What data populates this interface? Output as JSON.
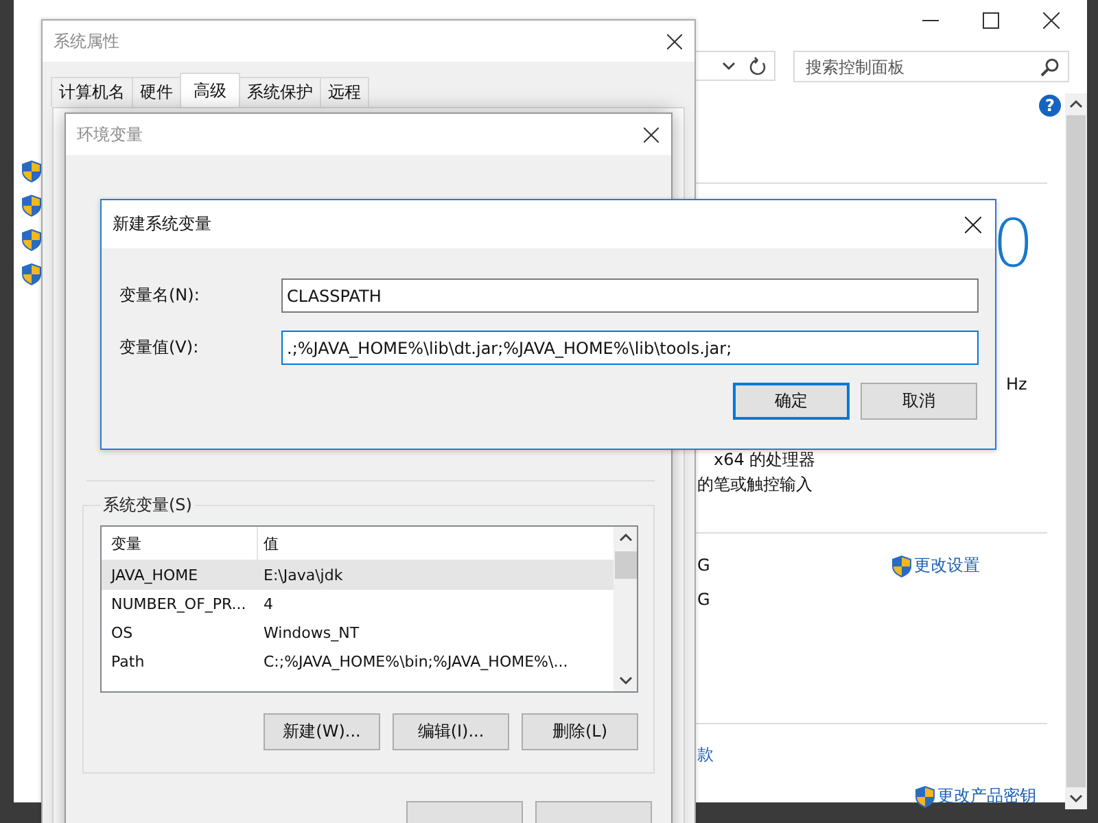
{
  "control_panel": {
    "search": {
      "placeholder": "搜索控制面板"
    },
    "help": "?",
    "big_text": "0",
    "processor_lines": [
      "Hz",
      "x64 的处理器",
      "的笔或触控输入"
    ],
    "memory_rows": [
      "G",
      "G"
    ],
    "change_settings_link": "更改设置",
    "partial_text": "款",
    "product_key_link": "更改产品密钥"
  },
  "system_properties": {
    "title": "系统属性",
    "tabs": [
      {
        "label": "计算机名",
        "selected": false
      },
      {
        "label": "硬件",
        "selected": false
      },
      {
        "label": "高级",
        "selected": true
      },
      {
        "label": "系统保护",
        "selected": false
      },
      {
        "label": "远程",
        "selected": false
      }
    ]
  },
  "environment_variables": {
    "title": "环境变量",
    "system_group": {
      "title": "系统变量(S)",
      "columns": [
        "变量",
        "值"
      ],
      "rows": [
        {
          "name": "JAVA_HOME",
          "value": "E:\\Java\\jdk",
          "selected": true
        },
        {
          "name": "NUMBER_OF_PR...",
          "value": "4",
          "selected": false
        },
        {
          "name": "OS",
          "value": "Windows_NT",
          "selected": false
        },
        {
          "name": "Path",
          "value": "C:;%JAVA_HOME%\\bin;%JAVA_HOME%\\...",
          "selected": false
        }
      ],
      "buttons": [
        "新建(W)...",
        "编辑(I)...",
        "删除(L)"
      ]
    }
  },
  "new_variable_dialog": {
    "title": "新建系统变量",
    "fields": [
      {
        "label": "变量名(N):",
        "value": "CLASSPATH",
        "focused": false
      },
      {
        "label": "变量值(V):",
        "value": ".;%JAVA_HOME%\\lib\\dt.jar;%JAVA_HOME%\\lib\\tools.jar;",
        "focused": true
      }
    ],
    "buttons": [
      {
        "label": "确定",
        "default": true
      },
      {
        "label": "取消",
        "default": false
      }
    ]
  }
}
